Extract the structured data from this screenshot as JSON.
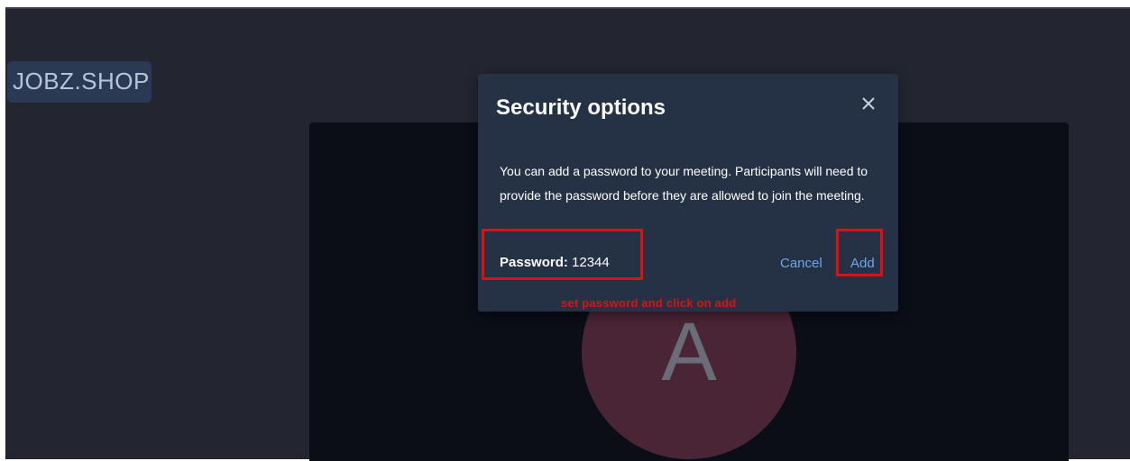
{
  "logo": {
    "text": "JOBZ.SHOP"
  },
  "participant": {
    "initial": "A"
  },
  "dialog": {
    "title": "Security options",
    "close_icon": "close-icon",
    "description": "You can add a password to your meeting. Participants will need to provide the password before they are allowed to join the meeting.",
    "password_label": "Password:",
    "password_value": "12344",
    "cancel_label": "Cancel",
    "add_label": "Add"
  },
  "annotation": {
    "text": "set password and click on add",
    "color": "#e01010"
  },
  "colors": {
    "background": "#232631",
    "stage": "#0b0e17",
    "dialog": "#253245",
    "link": "#6ba6e8",
    "avatar": "#4a2535"
  }
}
